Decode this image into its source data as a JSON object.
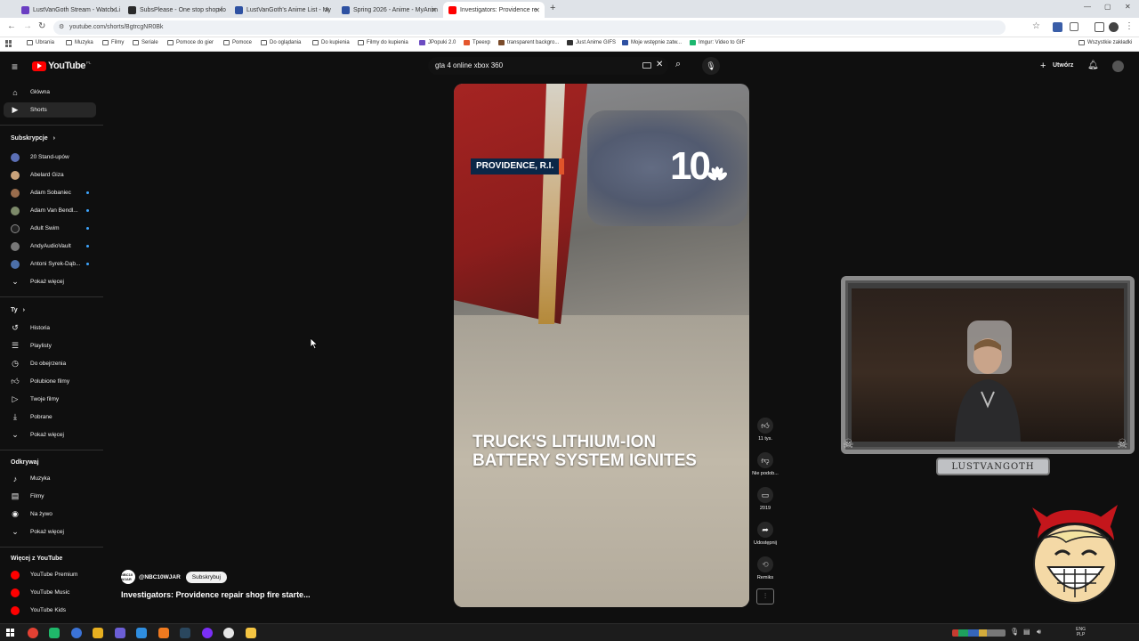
{
  "browser": {
    "tabs": [
      {
        "title": "LustVanGoth Stream - Watch Li",
        "color": "#6a3ec2"
      },
      {
        "title": "SubsPlease - One stop shop fo",
        "color": "#2a2a2a"
      },
      {
        "title": "LustVanGoth's Anime List - My",
        "color": "#2e51a2"
      },
      {
        "title": "Spring 2026 - Anime - MyAnim",
        "color": "#2e51a2"
      },
      {
        "title": "Investigators: Providence re",
        "color": "#ff0000"
      }
    ],
    "url": "youtube.com/shorts/BgtrcgNR0Bk",
    "bookmarks": [
      "Ubrania",
      "Muzyka",
      "Filmy",
      "Seriale",
      "Pomoce do gier",
      "Pomoce",
      "Do oglądania",
      "Do kupienia",
      "Filmy do kupienia",
      "JPopuki 2.0",
      "Tpeexp",
      "transparent backgro...",
      "Just Anime GIFS",
      "Moje wstępnie zatw...",
      "Imgur: Video to GIF"
    ],
    "bookmarks_right": "Wszystkie zakładki"
  },
  "youtube": {
    "logo_text": "YouTube",
    "logo_region": "PL",
    "search_value": "gta 4 online xbox 360",
    "create_label": "Utwórz"
  },
  "sidebar": {
    "top": [
      {
        "label": "Główna",
        "icon": "home-icon"
      },
      {
        "label": "Shorts",
        "icon": "shorts-icon",
        "active": true
      }
    ],
    "subscriptions_header": "Subskrypcje",
    "subscriptions": [
      {
        "label": "20 Stand-upów",
        "color": "#5b6fb5",
        "dot": false
      },
      {
        "label": "Abelard Giza",
        "color": "#c9a27a",
        "dot": false
      },
      {
        "label": "Adam Sobaniec",
        "color": "#9a6d4d",
        "dot": true
      },
      {
        "label": "Adam Van Bendl...",
        "color": "#7d8a6a",
        "dot": true
      },
      {
        "label": "Adult Swim",
        "color": "#222222",
        "dot": true
      },
      {
        "label": "AndyAudioVault",
        "color": "#777777",
        "dot": true
      },
      {
        "label": "Antoni Syrek-Dąb...",
        "color": "#4c6fa8",
        "dot": true
      }
    ],
    "subs_more": "Pokaż więcej",
    "you_header": "Ty",
    "you": [
      {
        "label": "Historia",
        "icon": "history-icon"
      },
      {
        "label": "Playlisty",
        "icon": "playlist-icon"
      },
      {
        "label": "Do obejrzenia",
        "icon": "watch-later-icon"
      },
      {
        "label": "Polubione filmy",
        "icon": "liked-icon"
      },
      {
        "label": "Twoje filmy",
        "icon": "your-videos-icon"
      },
      {
        "label": "Pobrane",
        "icon": "download-icon"
      },
      {
        "label": "Pokaż więcej",
        "icon": "chevron-down-icon"
      }
    ],
    "explore_header": "Odkrywaj",
    "explore": [
      {
        "label": "Muzyka",
        "icon": "music-icon"
      },
      {
        "label": "Filmy",
        "icon": "film-icon"
      },
      {
        "label": "Na żywo",
        "icon": "live-icon"
      },
      {
        "label": "Pokaż więcej",
        "icon": "chevron-down-icon"
      }
    ],
    "more_header": "Więcej z YouTube",
    "more": [
      {
        "label": "YouTube Premium",
        "color": "#ff0000"
      },
      {
        "label": "YouTube Music",
        "color": "#ff0000"
      },
      {
        "label": "YouTube Kids",
        "color": "#ff0000"
      }
    ]
  },
  "short": {
    "location_badge": "PROVIDENCE, R.I.",
    "channel_number": "10",
    "headline": "TRUCK'S LITHIUM-ION BATTERY SYSTEM IGNITES",
    "channel_avatar_text": "NBC10 WJAR",
    "channel_name": "@NBC10WJAR",
    "subscribe_label": "Subskrybuj",
    "title": "Investigators: Providence repair shop fire starte..."
  },
  "actions": {
    "like_count": "11 tys.",
    "dislike_label": "Nie podob...",
    "comments_count": "2019",
    "share_label": "Udostępnij",
    "remix_label": "Remiks"
  },
  "overlay": {
    "cam_label": "LUSTVANGOTH"
  },
  "taskbar": {
    "lang_top": "ENG",
    "lang_bottom": "PLP"
  }
}
